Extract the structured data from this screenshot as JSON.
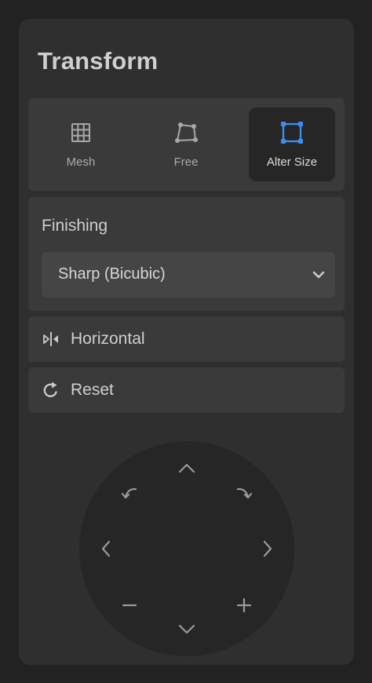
{
  "panel": {
    "title": "Transform"
  },
  "modes": [
    {
      "label": "Mesh",
      "icon": "mesh-grid-icon",
      "active": false
    },
    {
      "label": "Free",
      "icon": "free-transform-icon",
      "active": false
    },
    {
      "label": "Alter Size",
      "icon": "alter-size-icon",
      "active": true
    }
  ],
  "finishing": {
    "label": "Finishing",
    "selected": "Sharp (Bicubic)"
  },
  "actions": {
    "horizontal_label": "Horizontal",
    "reset_label": "Reset"
  },
  "colors": {
    "accent": "#3b8ef0",
    "panel": "#2f2f2f",
    "card": "#3a3a3a"
  },
  "dpad": [
    "up",
    "rotate-left",
    "rotate-right",
    "left",
    "right",
    "zoom-out",
    "zoom-in",
    "down"
  ]
}
